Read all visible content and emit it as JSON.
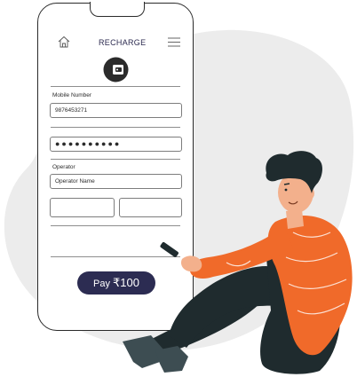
{
  "screen": {
    "title": "RECHARGE",
    "home_icon": "home-icon",
    "menu_icon": "hamburger-menu-icon",
    "logo_icon": "wallet-logo-icon"
  },
  "form": {
    "mobile_label": "Mobile Number",
    "mobile_value": "9876453271",
    "password_value": "●●●●●●●●●●",
    "operator_label": "Operator",
    "operator_value": "Operator Name"
  },
  "pay_button": {
    "label": "Pay",
    "amount": "₹100"
  },
  "colors": {
    "accent": "#2c2c52",
    "shirt": "#f06a2a",
    "blob": "#ececec"
  }
}
